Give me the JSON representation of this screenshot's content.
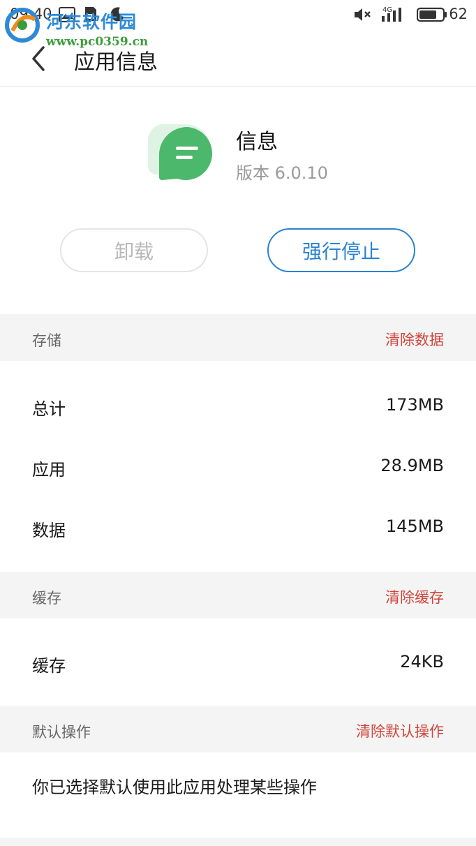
{
  "status_bar": {
    "time": "09:40",
    "network": "4G",
    "battery": "62",
    "watermark_title": "河东软件园",
    "watermark_url": "www.pc0359.cn"
  },
  "header": {
    "title": "应用信息"
  },
  "app": {
    "name": "信息",
    "version": "版本 6.0.10",
    "icon_color": "#4cb86b"
  },
  "buttons": {
    "uninstall": "卸载",
    "force_stop": "强行停止"
  },
  "storage": {
    "label": "存储",
    "action": "清除数据",
    "rows": [
      {
        "label": "总计",
        "value": "173MB"
      },
      {
        "label": "应用",
        "value": "28.9MB"
      },
      {
        "label": "数据",
        "value": "145MB"
      }
    ]
  },
  "cache": {
    "label": "缓存",
    "action": "清除缓存",
    "rows": [
      {
        "label": "缓存",
        "value": "24KB"
      }
    ]
  },
  "defaults": {
    "label": "默认操作",
    "action": "清除默认操作",
    "text": "你已选择默认使用此应用处理某些操作"
  },
  "colors": {
    "accent_blue": "#2a82d0",
    "danger_red": "#d0453c"
  }
}
